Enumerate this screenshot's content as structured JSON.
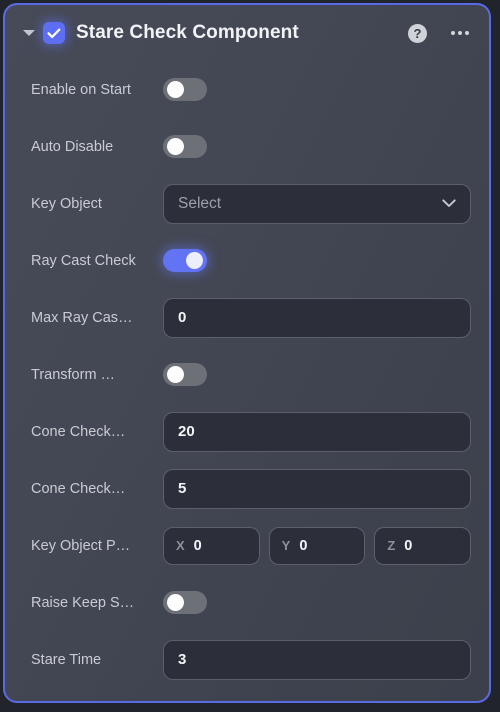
{
  "panel": {
    "title": "Stare Check Component",
    "expanded_icon": "caret-down-icon",
    "enabled": true,
    "help_label": "?",
    "accent_color": "#5d6ef2",
    "border_color": "#5a6ae4",
    "toggle_on_color": "#6274f3",
    "toggle_off_color": "#6e7078"
  },
  "rows": [
    {
      "label": "Enable on Start",
      "type": "toggle",
      "value": "off"
    },
    {
      "label": "Auto Disable",
      "type": "toggle",
      "value": "off"
    },
    {
      "label": "Key Object",
      "type": "select",
      "value": "",
      "placeholder": "Select"
    },
    {
      "label": "Ray Cast Check",
      "type": "toggle",
      "value": "on"
    },
    {
      "label": "Max Ray Cas…",
      "type": "number",
      "value": "0"
    },
    {
      "label": "Transform …",
      "type": "toggle",
      "value": "off"
    },
    {
      "label": "Cone Check…",
      "type": "number",
      "value": "20"
    },
    {
      "label": "Cone Check…",
      "type": "number",
      "value": "5"
    },
    {
      "label": "Key Object P…",
      "type": "vector",
      "axes": [
        {
          "axis": "X",
          "value": "0"
        },
        {
          "axis": "Y",
          "value": "0"
        },
        {
          "axis": "Z",
          "value": "0"
        }
      ]
    },
    {
      "label": "Raise Keep S…",
      "type": "toggle",
      "value": "off"
    },
    {
      "label": "Stare Time",
      "type": "number",
      "value": "3"
    }
  ]
}
